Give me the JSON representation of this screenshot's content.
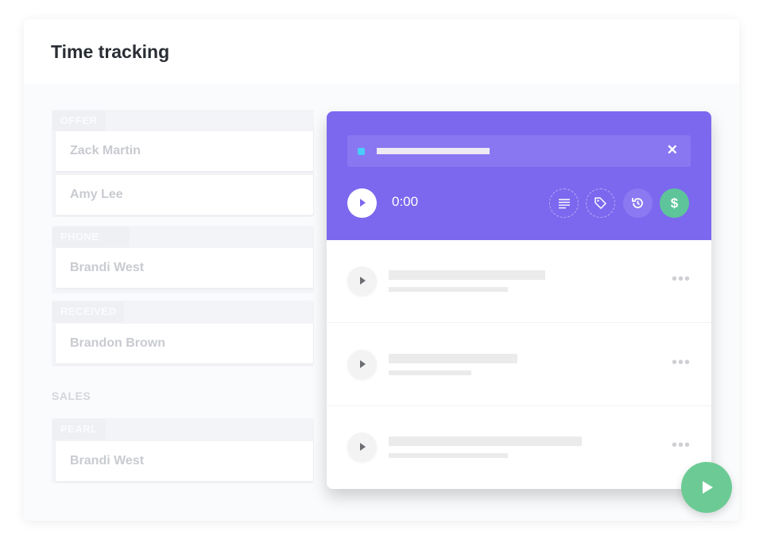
{
  "title": "Time tracking",
  "pipeline": {
    "groups": [
      {
        "tag": "OFFER SENT",
        "items": [
          "Zack Martin",
          "Amy Lee"
        ]
      },
      {
        "tag": "PHONE INTERVIEW",
        "items": [
          "Brandi West"
        ]
      },
      {
        "tag": "RECEIVED PROJECT",
        "items": [
          "Brandon Brown"
        ]
      }
    ],
    "section": "SALES",
    "sales_group": {
      "tag": "PEARL",
      "items": [
        "Brandi West"
      ]
    }
  },
  "timer": {
    "elapsed": "0:00",
    "tag_color": "#49ccf9",
    "accent": "#7b68ee",
    "billable_color": "#5ec49a",
    "icons": [
      "play-icon",
      "description-icon",
      "tag-icon",
      "history-icon",
      "dollar-icon",
      "close-icon"
    ],
    "billable_symbol": "$",
    "close_symbol": "✕"
  },
  "entries_count_visible": 3,
  "more_symbol": "•••"
}
